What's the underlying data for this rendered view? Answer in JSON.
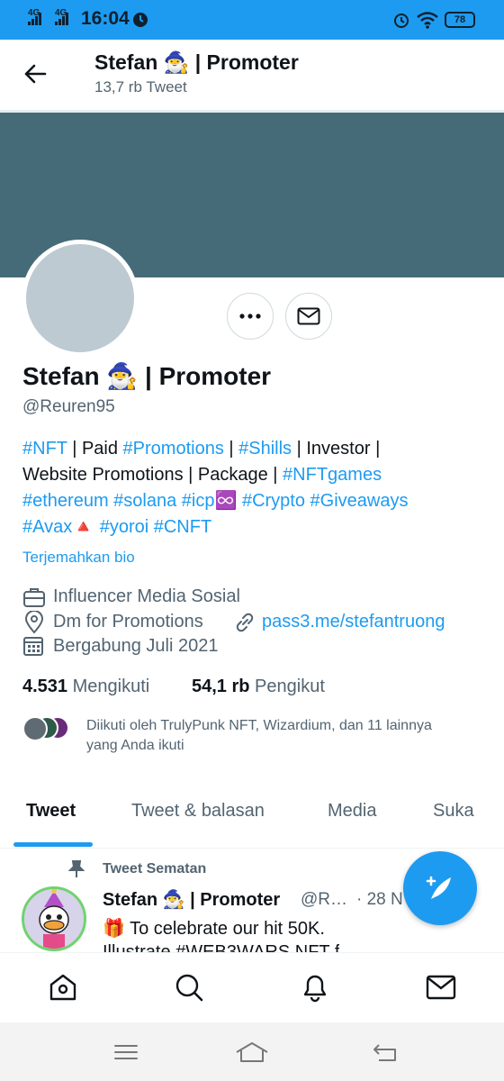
{
  "status_bar": {
    "signal_1": "4G",
    "signal_2": "4G",
    "time": "16:04",
    "battery": "78"
  },
  "header": {
    "title": "Stefan 🧙‍♂️ | Promoter",
    "tweet_count": "13,7 rb Tweet"
  },
  "profile": {
    "name": "Stefan 🧙‍♂️ | Promoter",
    "handle": "@Reuren95",
    "bio_lines": [
      [
        {
          "t": "#NFT",
          "tag": true
        },
        {
          "t": " | Paid ",
          "tag": false
        },
        {
          "t": "#Promotions",
          "tag": true
        },
        {
          "t": " | ",
          "tag": false
        },
        {
          "t": "#Shills",
          "tag": true
        },
        {
          "t": " | Investor |",
          "tag": false
        }
      ],
      [
        {
          "t": "Website Promotions | Package | ",
          "tag": false
        },
        {
          "t": "#NFTgames",
          "tag": true
        }
      ],
      [
        {
          "t": "#ethereum #solana #icp",
          "tag": true
        },
        {
          "t": "♾️ ",
          "tag": false
        },
        {
          "t": "#Crypto #Giveaways",
          "tag": true
        }
      ],
      [
        {
          "t": " #Avax",
          "tag": true
        },
        {
          "t": "🔺 ",
          "tag": false
        },
        {
          "t": "#yoroi #CNFT",
          "tag": true
        }
      ]
    ],
    "translate_bio": "Terjemahkan bio",
    "category": "Influencer Media Sosial",
    "location": "Dm for Promotions",
    "link": "pass3.me/stefantruong",
    "joined": "Bergabung Juli 2021",
    "following_count": "4.531",
    "following_label": "Mengikuti",
    "followers_count": "54,1 rb",
    "followers_label": "Pengikut",
    "followed_by": "Diikuti oleh TrulyPunk NFT, Wizardium, dan 11 lainnya yang Anda ikuti"
  },
  "tabs": [
    {
      "label": "Tweet",
      "active": true
    },
    {
      "label": "Tweet & balasan",
      "active": false
    },
    {
      "label": "Media",
      "active": false
    },
    {
      "label": "Suka",
      "active": false
    }
  ],
  "pinned_tweet": {
    "pinned_label": "Tweet Sematan",
    "author_name": "Stefan 🧙‍♂️ | Promoter",
    "author_handle": "@R…",
    "date": "· 28 N",
    "text_line1": "🎁 To celebrate our hit 50K.",
    "text_line2": "Illustrate #WEB3WARS NFT f"
  },
  "colors": {
    "accent": "#1d9bf0",
    "banner": "#456b78",
    "muted_text": "#536471"
  },
  "icons": {
    "back": "arrow-left-icon",
    "more": "more-horizontal-icon",
    "message": "envelope-icon",
    "category": "briefcase-icon",
    "location": "location-pin-icon",
    "link": "link-icon",
    "calendar": "calendar-icon",
    "compose": "compose-tweet-icon"
  }
}
